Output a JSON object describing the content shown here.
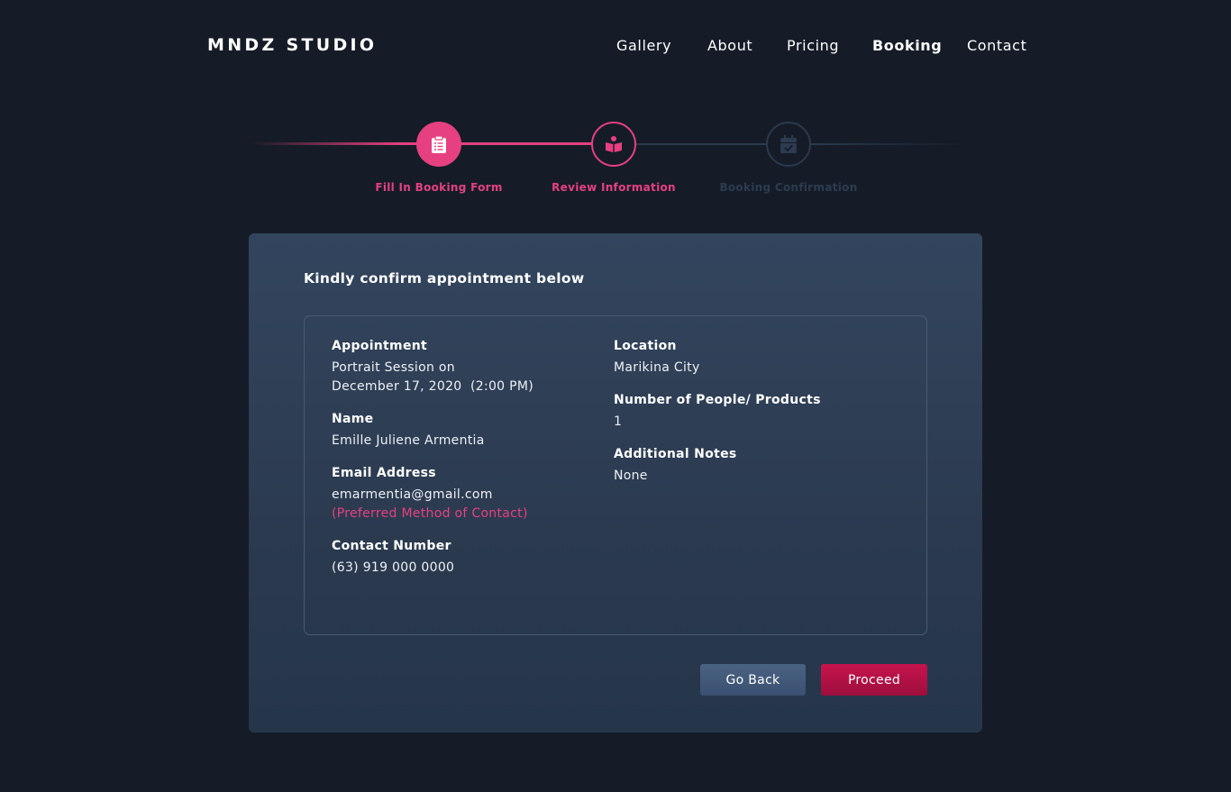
{
  "header": {
    "logo": "MNDZ STUDIO",
    "nav": [
      {
        "label": "Gallery",
        "active": false
      },
      {
        "label": "About",
        "active": false
      },
      {
        "label": "Pricing",
        "active": false
      },
      {
        "label": "Booking",
        "active": true
      },
      {
        "label": "Contact",
        "active": false
      }
    ]
  },
  "stepper": {
    "steps": [
      {
        "label": "Fill In Booking Form",
        "icon": "clipboard-list-icon",
        "state": "complete"
      },
      {
        "label": "Review Information",
        "icon": "book-reader-icon",
        "state": "current"
      },
      {
        "label": "Booking Confirmation",
        "icon": "calendar-check-icon",
        "state": "upcoming"
      }
    ]
  },
  "card": {
    "title": "Kindly confirm appointment below",
    "left_fields": [
      {
        "label": "Appointment",
        "lines": [
          "Portrait Session on",
          "December 17, 2020  (2:00 PM)"
        ]
      },
      {
        "label": "Name",
        "lines": [
          "Emille Juliene Armentia"
        ]
      },
      {
        "label": "Email Address",
        "lines": [
          "emarmentia@gmail.com"
        ],
        "note": "(Preferred Method of Contact)"
      },
      {
        "label": "Contact Number",
        "lines": [
          "(63) 919 000 0000"
        ]
      }
    ],
    "right_fields": [
      {
        "label": "Location",
        "lines": [
          "Marikina City"
        ]
      },
      {
        "label": "Number of People/ Products",
        "lines": [
          "1"
        ]
      },
      {
        "label": "Additional Notes",
        "lines": [
          "None"
        ]
      }
    ],
    "buttons": {
      "back_label": "Go Back",
      "proceed_label": "Proceed"
    }
  },
  "colors": {
    "background": "#151c27",
    "accent": "#e64080",
    "card": "#2f4058",
    "back_button": "#41587a",
    "proceed_button": "#b5124a",
    "inactive": "#2a3a4e"
  }
}
